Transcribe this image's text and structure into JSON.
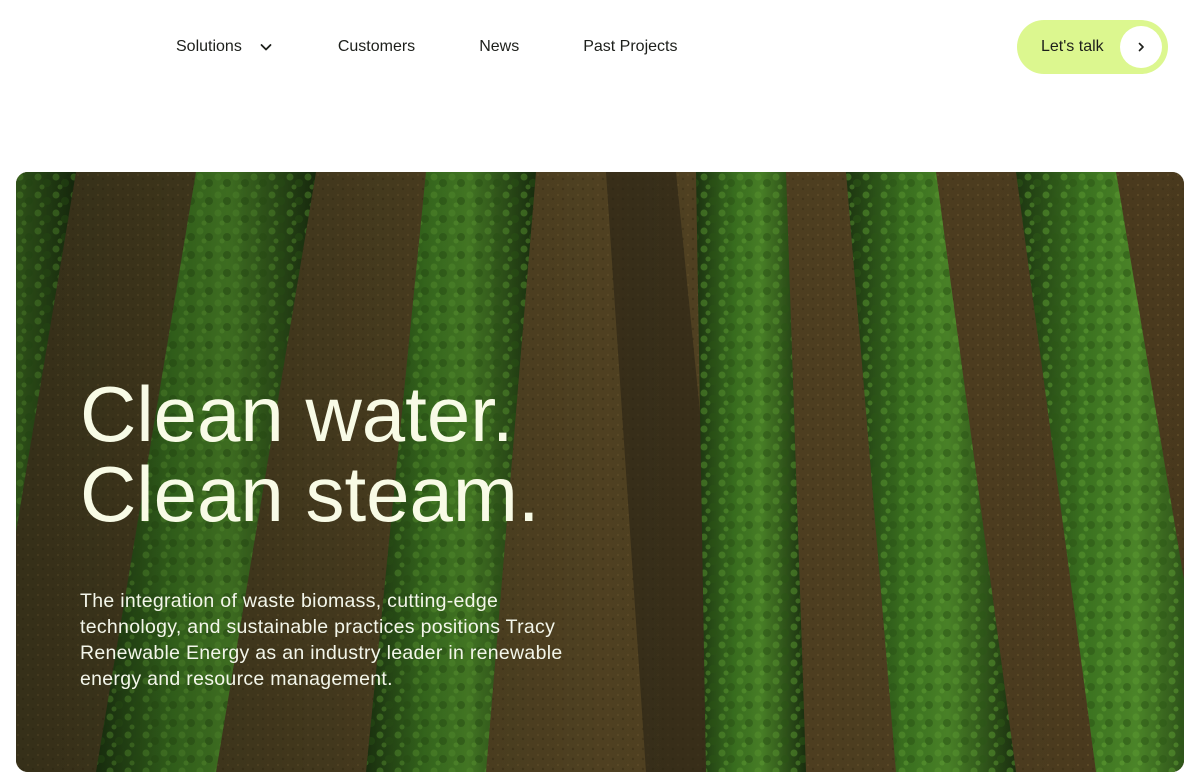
{
  "nav": {
    "items": [
      {
        "label": "Solutions"
      },
      {
        "label": "Customers"
      },
      {
        "label": "News"
      },
      {
        "label": "Past Projects"
      }
    ],
    "solutions_dropdown_icon": "chevron-down-icon",
    "cta": {
      "label": "Let's talk",
      "icon": "chevron-right-icon",
      "color": "#dcf78f"
    }
  },
  "hero": {
    "title_line1": "Clean water.",
    "title_line2": "Clean steam.",
    "description": "The integration of waste biomass, cutting-edge technology, and sustainable practices positions Tracy Renewable Energy as an industry leader in renewable energy and resource management.",
    "background": "aerial-orchard-rows-image",
    "text_color": "#f8fbe6"
  }
}
